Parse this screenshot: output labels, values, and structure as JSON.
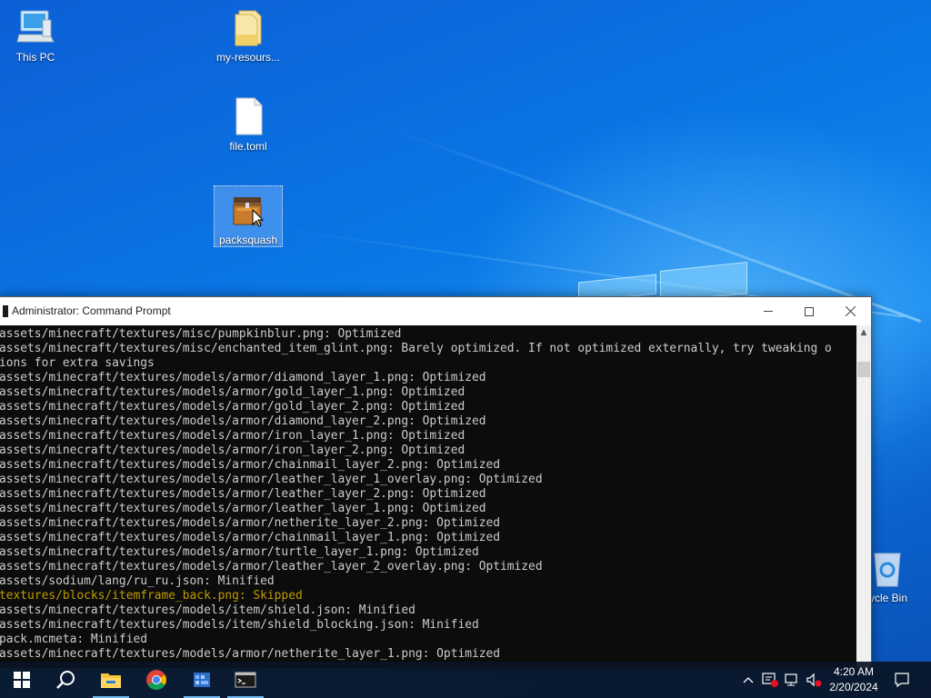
{
  "desktop": {
    "icons": [
      {
        "label": "This PC",
        "icon": "computer-icon"
      },
      {
        "label": "my-resours...",
        "icon": "folder-icon"
      },
      {
        "label": "file.toml",
        "icon": "file-icon"
      },
      {
        "label": "packsquash",
        "icon": "packsquash-app-icon"
      },
      {
        "label": "cycle Bin",
        "icon": "recycle-bin-icon"
      }
    ]
  },
  "cmd": {
    "title": "Administrator: Command Prompt",
    "lines": [
      "assets/minecraft/textures/misc/pumpkinblur.png: Optimized",
      "assets/minecraft/textures/misc/enchanted_item_glint.png: Barely optimized. If not optimized externally, try tweaking o",
      "ions for extra savings",
      "assets/minecraft/textures/models/armor/diamond_layer_1.png: Optimized",
      "assets/minecraft/textures/models/armor/gold_layer_1.png: Optimized",
      "assets/minecraft/textures/models/armor/gold_layer_2.png: Optimized",
      "assets/minecraft/textures/models/armor/diamond_layer_2.png: Optimized",
      "assets/minecraft/textures/models/armor/iron_layer_1.png: Optimized",
      "assets/minecraft/textures/models/armor/iron_layer_2.png: Optimized",
      "assets/minecraft/textures/models/armor/chainmail_layer_2.png: Optimized",
      "assets/minecraft/textures/models/armor/leather_layer_1_overlay.png: Optimized",
      "assets/minecraft/textures/models/armor/leather_layer_2.png: Optimized",
      "assets/minecraft/textures/models/armor/leather_layer_1.png: Optimized",
      "assets/minecraft/textures/models/armor/netherite_layer_2.png: Optimized",
      "assets/minecraft/textures/models/armor/chainmail_layer_1.png: Optimized",
      "assets/minecraft/textures/models/armor/turtle_layer_1.png: Optimized",
      "assets/minecraft/textures/models/armor/leather_layer_2_overlay.png: Optimized",
      "assets/sodium/lang/ru_ru.json: Minified",
      "textures/blocks/itemframe_back.png: Skipped",
      "assets/minecraft/textures/models/item/shield.json: Minified",
      "assets/minecraft/textures/models/item/shield_blocking.json: Minified",
      "pack.mcmeta: Minified",
      "assets/minecraft/textures/models/armor/netherite_layer_1.png: Optimized"
    ],
    "skipped_line_color": "#c19c00",
    "text_color": "#cccccc"
  },
  "taskbar": {
    "items": [
      {
        "name": "start-button",
        "icon": "windows-logo-icon"
      },
      {
        "name": "search-button",
        "icon": "search-icon"
      },
      {
        "name": "file-explorer-button",
        "icon": "folder-icon"
      },
      {
        "name": "chrome-button",
        "icon": "chrome-icon"
      },
      {
        "name": "packsquash-taskbar-button",
        "icon": "packsquash-app-icon"
      },
      {
        "name": "command-prompt-taskbar-button",
        "icon": "terminal-icon"
      }
    ],
    "tray": {
      "time": "4:20 AM",
      "date": "2/20/2024"
    }
  }
}
